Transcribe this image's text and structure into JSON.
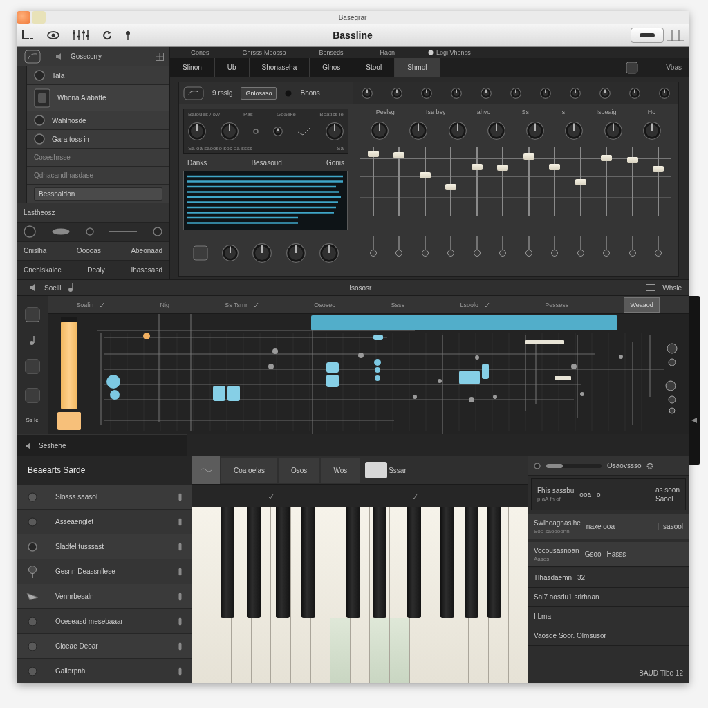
{
  "window": {
    "title": "Basegrar"
  },
  "toolbar": {
    "title": "Bassline"
  },
  "browser": {
    "header": "Gossccrry",
    "items": [
      {
        "kind": "dot",
        "label": "Tala"
      },
      {
        "kind": "thumb",
        "label": "Whona Alabatte"
      },
      {
        "kind": "dot",
        "label": "Wahlhosde"
      },
      {
        "kind": "dot",
        "label": "Gara toss in"
      },
      {
        "kind": "plain",
        "label": "Coseshrsse"
      },
      {
        "kind": "plain",
        "label": "Qdhacandlhasdase"
      },
      {
        "kind": "field",
        "label": "Bessnaldon"
      }
    ],
    "strips": [
      {
        "kind": "label",
        "texts": [
          "Lastheosz"
        ]
      },
      {
        "kind": "icons"
      },
      {
        "kind": "label",
        "texts": [
          "Cnislha",
          "Ooooas",
          "Abeonaad"
        ]
      },
      {
        "kind": "label",
        "texts": [
          "Cnehiskaloc",
          "Dealy",
          "Ihasasasd"
        ]
      }
    ]
  },
  "tabs": {
    "top": [
      "Gones",
      "Ghrsss-Moosso",
      "Bonsedsl-",
      "Haon",
      "Logi Vhonss"
    ],
    "items": [
      {
        "label": "Slinon",
        "selected": false
      },
      {
        "label": "Ub",
        "selected": false
      },
      {
        "label": "Shonaseha",
        "selected": false
      },
      {
        "label": "Glnos",
        "selected": false
      },
      {
        "label": "Stool",
        "selected": false
      },
      {
        "label": "Shmol",
        "selected": true
      }
    ],
    "right": "Vbas"
  },
  "synth": {
    "header": {
      "label": "9 rsslg",
      "button": "Gnlosaso",
      "name": "Bhons"
    },
    "osc": {
      "labels": [
        "Baloues / ow",
        "Pas",
        "Goaeke",
        "Boatiss ie"
      ],
      "caption": "Sa oa saooso sos oa ssss",
      "caption_right": "Sa"
    },
    "display_labels": [
      "Danks",
      "Besasoud",
      "Gonis"
    ],
    "knob_labels": [
      "Peslsg",
      "Ise bsy",
      "ahvo",
      "Ss",
      "Is",
      "Isoeaig",
      "Ho"
    ],
    "faders": [
      {
        "level": 0.95
      },
      {
        "level": 0.92
      },
      {
        "level": 0.6
      },
      {
        "level": 0.42
      },
      {
        "level": 0.74
      },
      {
        "level": 0.72
      },
      {
        "level": 0.9
      },
      {
        "level": 0.74
      },
      {
        "level": 0.5
      },
      {
        "level": 0.88
      },
      {
        "level": 0.85
      },
      {
        "level": 0.7
      }
    ]
  },
  "sequencer": {
    "section": {
      "left": "Soelil",
      "center": "Isososr",
      "right": "Whsle"
    },
    "columns": [
      "Soalin",
      "Nig",
      "Ss Tsrnr",
      "Ososeo",
      "Ssss",
      "Lsoolo",
      "Pessess"
    ],
    "button": "Weaaod",
    "tool_caption": "Ss Ie",
    "meter": {
      "level": 0.95
    },
    "footer": "Seshehe"
  },
  "presets": {
    "header": "Beaearts Sarde",
    "items": [
      {
        "kind": "dot",
        "label": "Slosss saasol"
      },
      {
        "kind": "dot",
        "label": "Asseaenglet"
      },
      {
        "kind": "ring",
        "label": "Sladfel tusssast"
      },
      {
        "kind": "pin",
        "label": "Gesnn Deassnllese"
      },
      {
        "kind": "feather",
        "label": "Vennrbesaln"
      },
      {
        "kind": "dot",
        "label": "Oceseasd mesebaaar"
      },
      {
        "kind": "dot",
        "label": "Cloeae Deoar"
      },
      {
        "kind": "dot",
        "label": "Gallerpnh"
      }
    ]
  },
  "keyboard": {
    "tabs": [
      "Coa oelas",
      "Osos",
      "Wos"
    ],
    "toggle": {
      "label": "Sssar",
      "on": true
    },
    "keys": [
      {
        "pressed": false
      },
      {
        "pressed": false
      },
      {
        "pressed": false
      },
      {
        "pressed": false
      },
      {
        "pressed": false
      },
      {
        "pressed": false
      },
      {
        "pressed": false
      },
      {
        "pressed": true
      },
      {
        "pressed": false
      },
      {
        "pressed": true
      },
      {
        "pressed": true
      },
      {
        "pressed": false
      },
      {
        "pressed": false
      },
      {
        "pressed": false
      },
      {
        "pressed": false
      },
      {
        "pressed": false
      },
      {
        "pressed": false
      }
    ]
  },
  "inspector": {
    "slider": {
      "label": "Osaovssso",
      "level": 0.3
    },
    "rows": [
      {
        "kind": "box",
        "title": "Fhis sassbu",
        "note": "p.aA fh of",
        "values": [
          "ooa",
          "o"
        ],
        "aside": [
          "as soon",
          "Saoel"
        ]
      },
      {
        "kind": "card",
        "title": "Swiheagnaslhe",
        "note": "Soo saoooohnl",
        "values": [
          "naxe ooa"
        ],
        "aside": [
          "sasool"
        ]
      },
      {
        "kind": "card",
        "title": "Vocousasnoan",
        "note": "Aasos",
        "values": [
          "Gsoo",
          "Hasss"
        ]
      },
      {
        "kind": "line",
        "title": "Tlhasdaemn",
        "values": [
          "32"
        ]
      },
      {
        "kind": "line",
        "title": "Sal7 aosdu1 srirhnan"
      },
      {
        "kind": "line",
        "values": [
          "I Lma"
        ]
      },
      {
        "kind": "line",
        "title": "Vaosde Soor. Olmsusor"
      }
    ],
    "footer": "BAUD Tlbe 12"
  }
}
